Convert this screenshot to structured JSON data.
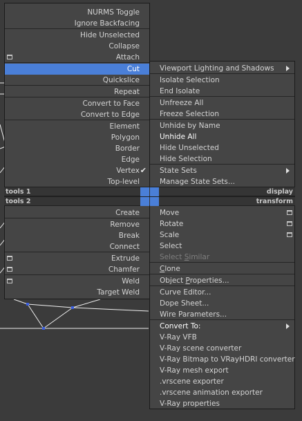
{
  "left_menu": {
    "items": [
      {
        "label": "NURMS Toggle"
      },
      {
        "label": "Ignore Backfacing"
      },
      {
        "label": "Hide Unselected"
      },
      {
        "label": "Collapse"
      },
      {
        "label": "Attach",
        "settings_icon": true
      },
      {
        "label": "Cut",
        "highlighted": true
      },
      {
        "label": "Quickslice"
      },
      {
        "label": "Repeat"
      },
      {
        "label": "Convert to Face"
      },
      {
        "label": "Convert to Edge"
      },
      {
        "label": "Element"
      },
      {
        "label": "Polygon"
      },
      {
        "label": "Border"
      },
      {
        "label": "Edge"
      },
      {
        "label": "Vertex",
        "checked": true
      },
      {
        "label": "Top-level"
      },
      {
        "label": "Create"
      },
      {
        "label": "Remove"
      },
      {
        "label": "Break"
      },
      {
        "label": "Connect"
      },
      {
        "label": "Extrude",
        "settings_icon": true
      },
      {
        "label": "Chamfer",
        "settings_icon": true
      },
      {
        "label": "Weld",
        "settings_icon": true
      },
      {
        "label": "Target Weld"
      }
    ]
  },
  "quad_bars": {
    "tools1": "tools 1",
    "display": "display",
    "tools2": "tools 2",
    "transform": "transform"
  },
  "right_menu": {
    "items": [
      {
        "label": "Viewport Lighting and Shadows",
        "submenu": true
      },
      {
        "label": "Isolate Selection"
      },
      {
        "label": "End Isolate"
      },
      {
        "label": "Unfreeze All"
      },
      {
        "label": "Freeze Selection"
      },
      {
        "label": "Unhide by Name"
      },
      {
        "label": "Unhide All",
        "bold": true
      },
      {
        "label": "Hide Unselected"
      },
      {
        "label": "Hide Selection"
      },
      {
        "label": "State Sets",
        "submenu": true
      },
      {
        "label": "Manage State Sets..."
      },
      {
        "label": "Move",
        "settings_icon": true
      },
      {
        "label": "Rotate",
        "settings_icon": true
      },
      {
        "label": "Scale",
        "settings_icon": true
      },
      {
        "label": "Select"
      },
      {
        "label": "Select Similar",
        "disabled": true,
        "ul": "S"
      },
      {
        "label": "Clone",
        "ul": "C"
      },
      {
        "label": "Object Properties...",
        "ul": "P"
      },
      {
        "label": "Curve Editor..."
      },
      {
        "label": "Dope Sheet..."
      },
      {
        "label": "Wire Parameters..."
      },
      {
        "label": "Convert To:",
        "bold": true,
        "submenu": true
      },
      {
        "label": "V-Ray VFB"
      },
      {
        "label": "V-Ray scene converter"
      },
      {
        "label": "V-Ray Bitmap to VRayHDRI converter"
      },
      {
        "label": "V-Ray mesh export"
      },
      {
        "label": ".vrscene exporter"
      },
      {
        "label": ".vrscene animation exporter"
      },
      {
        "label": "V-Ray properties"
      }
    ]
  },
  "colors": {
    "menu_bg": "#454545",
    "highlight": "#4a7fd8",
    "viewport_bg": "#3b3b3b",
    "wire": "#ffffff",
    "vertex": "#3b5fe0"
  }
}
